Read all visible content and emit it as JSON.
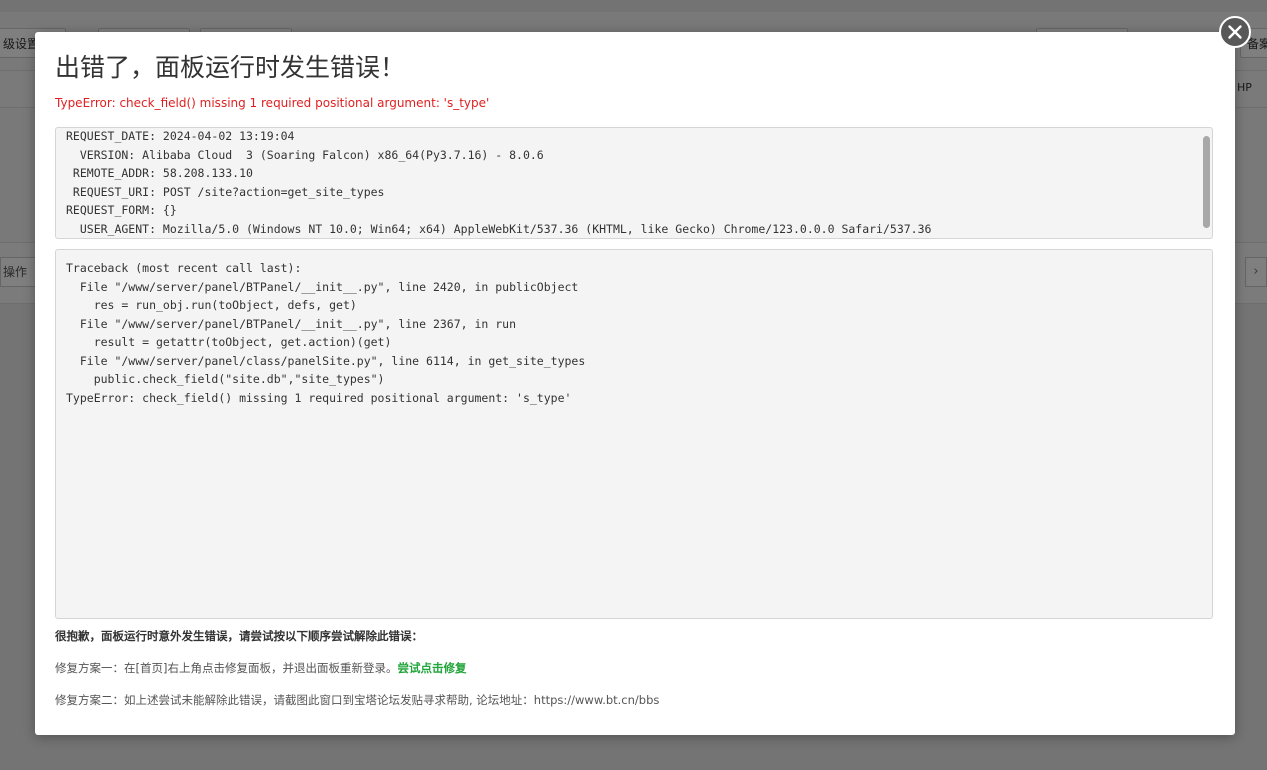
{
  "background": {
    "toolbar_buttons": [
      "级设置",
      "",
      "",
      "",
      "备案"
    ],
    "header_right_text": "HP",
    "operation_button": "操作",
    "next_icon": "chevron-right-icon"
  },
  "modal": {
    "title": "出错了，面板运行时发生错误！",
    "error_summary": "TypeError: check_field() missing 1 required positional argument: 's_type'",
    "request_lines": [
      "REQUEST_DATE: 2024-04-02 13:19:04",
      "  VERSION: Alibaba Cloud  3 (Soaring Falcon) x86_64(Py3.7.16) - 8.0.6",
      " REMOTE_ADDR: 58.208.133.10",
      " REQUEST_URI: POST /site?action=get_site_types",
      "REQUEST_FORM: {}",
      "  USER_AGENT: Mozilla/5.0 (Windows NT 10.0; Win64; x64) AppleWebKit/537.36 (KHTML, like Gecko) Chrome/123.0.0.0 Safari/537.36"
    ],
    "traceback_lines": [
      "Traceback (most recent call last):",
      "  File \"/www/server/panel/BTPanel/__init__.py\", line 2420, in publicObject",
      "    res = run_obj.run(toObject, defs, get)",
      "  File \"/www/server/panel/BTPanel/__init__.py\", line 2367, in run",
      "    result = getattr(toObject, get.action)(get)",
      "  File \"/www/server/panel/class/panelSite.py\", line 6114, in get_site_types",
      "    public.check_field(\"site.db\",\"site_types\")",
      "TypeError: check_field() missing 1 required positional argument: 's_type'"
    ],
    "notice": "很抱歉，面板运行时意外发生错误，请尝试按以下顺序尝试解除此错误：",
    "fix_one_text": "修复方案一：在[首页]右上角点击修复面板，并退出面板重新登录。",
    "fix_one_link": "尝试点击修复",
    "fix_two_text": "修复方案二：如上述尝试未能解除此错误，请截图此窗口到宝塔论坛发贴寻求帮助, 论坛地址：https://www.bt.cn/bbs",
    "close_icon": "close-icon",
    "colors": {
      "error_red": "#e02020",
      "link_green": "#20a53a",
      "code_background": "#f4f4f4"
    }
  }
}
